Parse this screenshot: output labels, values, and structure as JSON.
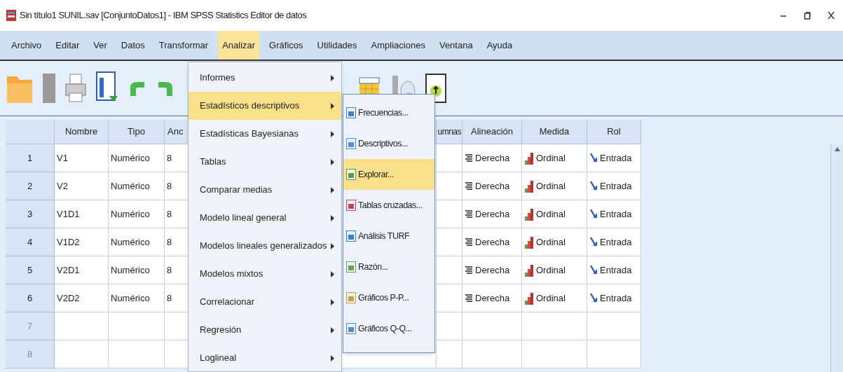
{
  "window": {
    "title": "Sin título1 SUNIL.sav [ConjuntoDatos1] - IBM SPSS Statistics Editor de datos"
  },
  "menu_bar": [
    {
      "label": "Archivo",
      "selected": false
    },
    {
      "label": "Editar",
      "selected": false
    },
    {
      "label": "Ver",
      "selected": false
    },
    {
      "label": "Datos",
      "selected": false
    },
    {
      "label": "Transformar",
      "selected": false
    },
    {
      "label": "Analizar",
      "selected": true
    },
    {
      "label": "Gráficos",
      "selected": false
    },
    {
      "label": "Utilidades",
      "selected": false
    },
    {
      "label": "Ampliaciones",
      "selected": false
    },
    {
      "label": "Ventana",
      "selected": false
    },
    {
      "label": "Ayuda",
      "selected": false
    }
  ],
  "table": {
    "columns": [
      "Nombre",
      "Tipo",
      "Anc",
      "umnas",
      "Alineación",
      "Medida",
      "Rol"
    ],
    "rows": [
      {
        "number": "1",
        "name": "V1",
        "type": "Numérico",
        "column_3": "8",
        "alignment": "Derecha",
        "measure": "Ordinal",
        "role": "Entrada"
      },
      {
        "number": "2",
        "name": "V2",
        "type": "Numérico",
        "column_3": "8",
        "alignment": "Derecha",
        "measure": "Ordinal",
        "role": "Entrada"
      },
      {
        "number": "3",
        "name": "V1D1",
        "type": "Numérico",
        "column_3": "8",
        "alignment": "Derecha",
        "measure": "Ordinal",
        "role": "Entrada"
      },
      {
        "number": "4",
        "name": "V1D2",
        "type": "Numérico",
        "column_3": "8",
        "alignment": "Derecha",
        "measure": "Ordinal",
        "role": "Entrada"
      },
      {
        "number": "5",
        "name": "V2D1",
        "type": "Numérico",
        "column_3": "8",
        "alignment": "Derecha",
        "measure": "Ordinal",
        "role": "Entrada"
      },
      {
        "number": "6",
        "name": "V2D2",
        "type": "Numérico",
        "column_3": "8",
        "alignment": "Derecha",
        "measure": "Ordinal",
        "role": "Entrada"
      },
      {
        "number": "7"
      },
      {
        "number": "8"
      }
    ]
  },
  "menu": {
    "items": [
      {
        "label": "Informes",
        "selected": false
      },
      {
        "label": "Estadísticos descriptivos",
        "selected": true
      },
      {
        "label": "Estadísticas Bayesianas",
        "selected": false
      },
      {
        "label": "Tablas",
        "selected": false
      },
      {
        "label": "Comparar medias",
        "selected": false
      },
      {
        "label": "Modelo lineal general",
        "selected": false
      },
      {
        "label": "Modelos lineales generalizados",
        "selected": false
      },
      {
        "label": "Modelos mixtos",
        "selected": false
      },
      {
        "label": "Correlacionar",
        "selected": false
      },
      {
        "label": "Regresión",
        "selected": false
      },
      {
        "label": "Loglineal",
        "selected": false
      }
    ]
  },
  "submenu": {
    "items": [
      {
        "label": "Frecuencias...",
        "selected": false
      },
      {
        "label": "Descriptivos...",
        "selected": false
      },
      {
        "label": "Explorar...",
        "selected": true
      },
      {
        "label": "Tablas cruzadas...",
        "selected": false
      },
      {
        "label": "Análisis TURF",
        "selected": false
      },
      {
        "label": "Razón...",
        "selected": false
      },
      {
        "label": "Gráficos P-P...",
        "selected": false
      },
      {
        "label": "Gráficos Q-Q...",
        "selected": false
      }
    ]
  }
}
